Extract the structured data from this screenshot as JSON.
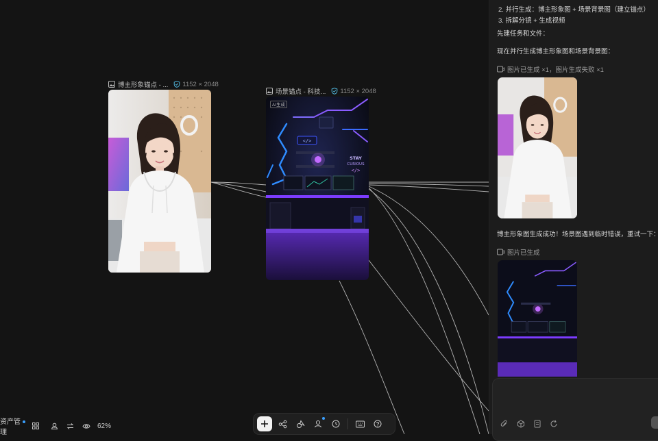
{
  "canvas": {
    "nodes": [
      {
        "title": "博主形象锚点 - ...",
        "dimensions": "1152 × 2048",
        "icon": "image-icon",
        "badge_icon": "shield-check-icon"
      },
      {
        "title": "场景锚点 - 科技...",
        "dimensions": "1152 × 2048",
        "icon": "image-icon",
        "badge_icon": "shield-check-icon",
        "ai_badge": "AI生成",
        "neon_text": [
          "STAY",
          "CURIOUS",
          "</>"
        ]
      }
    ]
  },
  "chat": {
    "steps": [
      "2. 并行生成：博主形象图 + 场景背景图（建立锚点）",
      "3. 拆解分镜 + 生成视频"
    ],
    "msg_create": "先建任务和文件：",
    "msg_parallel": "现在并行生成博主形象图和场景背景图：",
    "status_1": "图片已生成 ×1，图片生成失败 ×1",
    "msg_success": "博主形象图生成成功！场景图遇到临时错误，重试一下：",
    "status_2": "图片已生成",
    "composer_icons": [
      "paperclip-icon",
      "cube-icon",
      "document-icon",
      "refresh-icon"
    ]
  },
  "statusbar": {
    "assets_label": "资产管理",
    "zoom": "62%",
    "icons": [
      "grid-icon",
      "stamp-icon",
      "swap-icon",
      "eye-icon"
    ]
  },
  "toolbar": {
    "buttons": [
      "add-icon",
      "workflow-icon",
      "shapes-icon",
      "person-icon",
      "clock-icon",
      "keyboard-icon",
      "help-icon"
    ]
  },
  "colors": {
    "background": "#141414",
    "panel": "#1c1c1c",
    "accent": "#3aa0ff",
    "neon_blue": "#2f6bff",
    "neon_purple": "#8a3cff"
  }
}
